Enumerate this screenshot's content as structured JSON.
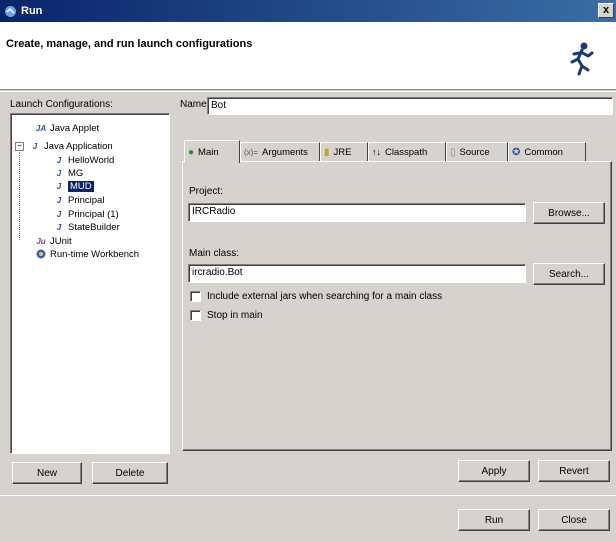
{
  "window": {
    "title": "Run",
    "close_symbol": "x"
  },
  "banner": {
    "heading": "Create, manage, and run launch configurations"
  },
  "launch_configs": {
    "label": "Launch Configurations:",
    "items": [
      {
        "label": "Java Applet",
        "icon": "java-applet-icon"
      },
      {
        "label": "Java Application",
        "icon": "java-application-icon"
      },
      {
        "label": "HelloWorld",
        "icon": "java-class-icon"
      },
      {
        "label": "MG",
        "icon": "java-class-icon"
      },
      {
        "label": "MUD",
        "icon": "java-class-icon"
      },
      {
        "label": "Principal",
        "icon": "java-class-icon"
      },
      {
        "label": "Principal (1)",
        "icon": "java-class-icon"
      },
      {
        "label": "StateBuilder",
        "icon": "java-class-icon"
      },
      {
        "label": "JUnit",
        "icon": "junit-icon"
      },
      {
        "label": "Run-time Workbench",
        "icon": "workbench-icon"
      }
    ],
    "expander": "−",
    "new_label": "New",
    "delete_label": "Delete"
  },
  "name": {
    "label": "Name:",
    "value": "Bot"
  },
  "tabs": [
    {
      "label": "Main",
      "icon_glyph": "●"
    },
    {
      "label": "Arguments",
      "icon_glyph": "(x)="
    },
    {
      "label": "JRE",
      "icon_glyph": "▮"
    },
    {
      "label": "Classpath",
      "icon_glyph": "↑↓"
    },
    {
      "label": "Source",
      "icon_glyph": "▯"
    },
    {
      "label": "Common",
      "icon_glyph": "✪"
    }
  ],
  "main_tab": {
    "project_label": "Project:",
    "project_value": "IRCRadio",
    "browse_label": "Browse...",
    "main_class_label": "Main class:",
    "main_class_value": "ircradio.Bot",
    "search_label": "Search...",
    "include_external_label": "Include external jars when searching for a main class",
    "stop_in_main_label": "Stop in main"
  },
  "actions": {
    "apply": "Apply",
    "revert": "Revert",
    "run": "Run",
    "close": "Close"
  },
  "colors": {
    "titlebar": "#0a246a",
    "selection": "#0a246a",
    "face": "#d6d3ce",
    "accent_green": "#2e8b3a"
  }
}
